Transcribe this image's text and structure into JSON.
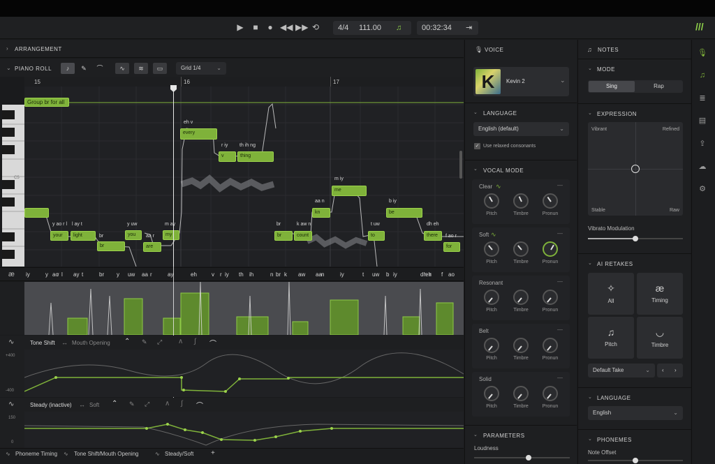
{
  "transport": {
    "time_sig": "4/4",
    "tempo": "111.00",
    "time": "00:32:34"
  },
  "arrangement": {
    "label": "ARRANGEMENT"
  },
  "piano_roll": {
    "label": "PIANO ROLL",
    "grid": "Grid 1/4",
    "bars": [
      "15",
      "16",
      "17"
    ],
    "group_label": "Group br for all",
    "c5_label": "C5"
  },
  "notes": [
    {
      "word": "",
      "phon": ""
    },
    {
      "word": "your",
      "phon": "y ao r l"
    },
    {
      "word": "light",
      "phon": "l ay t"
    },
    {
      "word": "br",
      "phon": "br"
    },
    {
      "word": "you",
      "phon": "y uw"
    },
    {
      "word": "are",
      "phon": "aa r"
    },
    {
      "word": "my",
      "phon": "m ay"
    },
    {
      "word": "every",
      "phon": "eh v"
    },
    {
      "word": "v",
      "phon": "r iy"
    },
    {
      "word": "thing",
      "phon": "th ih ng"
    },
    {
      "word": "br",
      "phon": "br"
    },
    {
      "word": "count",
      "phon": "k aw n"
    },
    {
      "word": "kn",
      "phon": "aa n"
    },
    {
      "word": "me",
      "phon": "m iy"
    },
    {
      "word": "to",
      "phon": "t uw"
    },
    {
      "word": "be",
      "phon": "b iy"
    },
    {
      "word": "there",
      "phon": "dh eh"
    },
    {
      "word": "for",
      "phon": "f ao r"
    }
  ],
  "phoneme_lane": {
    "icon": "ae-icon",
    "items": [
      "iy",
      "y",
      "ao",
      "r",
      "l",
      "ay",
      "t",
      "br",
      "y",
      "uw",
      "aa",
      "r",
      "ay",
      "eh",
      "v",
      "r",
      "iy",
      "th",
      "ih",
      "n",
      "br",
      "k",
      "aw",
      "aa",
      "n",
      "iy",
      "t",
      "uw",
      "b",
      "iy",
      "dh",
      "eh",
      "r",
      "f",
      "ao"
    ]
  },
  "tone_shift": {
    "label": "Tone Shift",
    "sub": "Mouth Opening",
    "ymax": "+400",
    "ymin": "-400"
  },
  "steady": {
    "label": "Steady (inactive)",
    "sub": "Soft",
    "ymax": "150",
    "ymin": "0"
  },
  "bottom_tabs": [
    "Phoneme Timing",
    "Tone Shift/Mouth Opening",
    "Steady/Soft",
    "+"
  ],
  "voice": {
    "title": "VOICE",
    "name": "Kevin 2",
    "avatar_letter": "K",
    "language_title": "LANGUAGE",
    "language": "English (default)",
    "relaxed": "Use relaxed consonants",
    "vocal_mode_title": "VOCAL MODE",
    "modes": [
      {
        "name": "Clear",
        "knobs": [
          "Pitch",
          "Timbre",
          "Pronun"
        ]
      },
      {
        "name": "Soft",
        "knobs": [
          "Pitch",
          "Timbre",
          "Pronun"
        ]
      },
      {
        "name": "Resonant",
        "knobs": [
          "Pitch",
          "Timbre",
          "Pronun"
        ]
      },
      {
        "name": "Belt",
        "knobs": [
          "Pitch",
          "Timbre",
          "Pronun"
        ]
      },
      {
        "name": "Solid",
        "knobs": [
          "Pitch",
          "Timbre",
          "Pronun"
        ]
      }
    ],
    "parameters_title": "PARAMETERS",
    "loudness": "Loudness"
  },
  "notes_panel": {
    "title": "NOTES",
    "mode_title": "MODE",
    "sing": "Sing",
    "rap": "Rap",
    "expression_title": "EXPRESSION",
    "vibrant": "Vibrant",
    "refined": "Refined",
    "stable": "Stable",
    "raw": "Raw",
    "vibrato": "Vibrato Modulation",
    "retakes_title": "AI RETAKES",
    "retakes": [
      "All",
      "Timing",
      "Pitch",
      "Timbre"
    ],
    "default_take": "Default Take",
    "language_title": "LANGUAGE",
    "language": "English",
    "phonemes_title": "PHONEMES",
    "note_offset": "Note Offset"
  },
  "colors": {
    "accent": "#7fb23a",
    "bg": "#1a1b1d"
  }
}
